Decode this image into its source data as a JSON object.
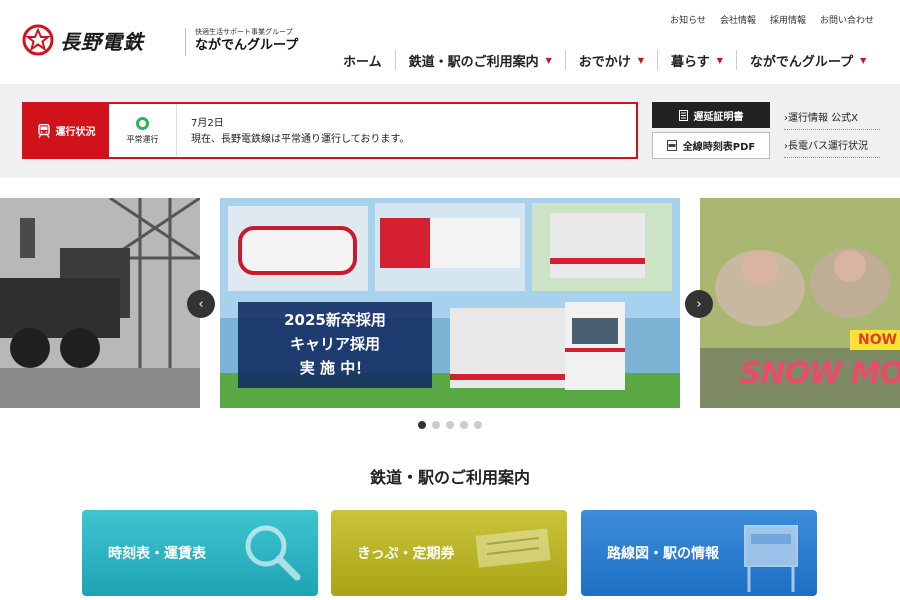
{
  "header": {
    "logo_text": "長野電鉄",
    "group_sub": "快適生活サポート事業グループ",
    "group_name": "ながでんグループ",
    "util_links": [
      "お知らせ",
      "会社情報",
      "採用情報",
      "お問い合わせ"
    ],
    "nav_items": [
      "ホーム",
      "鉄道・駅のご利用案内",
      "おでかけ",
      "暮らす",
      "ながでんグループ"
    ]
  },
  "status": {
    "label": "運行状況",
    "state": "平常運行",
    "date": "7月2日",
    "message": "現在、長野電鉄線は平常通り運行しております。",
    "delay_cert_button": "遅延証明書",
    "timetable_pdf_button": "全線時刻表PDF",
    "side_links": [
      "運行情報 公式X",
      "長電バス運行状況"
    ]
  },
  "carousel": {
    "banner_lines": [
      "2025新卒採用",
      "キャリア採用",
      "実 施 中！"
    ],
    "right_tag": "NOW",
    "right_text": "SNOW MO",
    "dot_count": 5,
    "active_dot": 0
  },
  "railway_guide": {
    "title": "鉄道・駅のご利用案内",
    "cards": [
      "時刻表・運賃表",
      "きっぷ・定期券",
      "路線図・駅の情報"
    ]
  },
  "colors": {
    "brand_red": "#d0121b",
    "normal_green": "#2fb35a",
    "card_teal": "#2cb3c2",
    "card_olive": "#b8b325",
    "card_blue": "#2a7ecf"
  },
  "icons": [
    "logo-mark",
    "train-icon",
    "document-icon",
    "pdf-icon",
    "chevron-left-icon",
    "chevron-right-icon",
    "magnifier-icon"
  ]
}
